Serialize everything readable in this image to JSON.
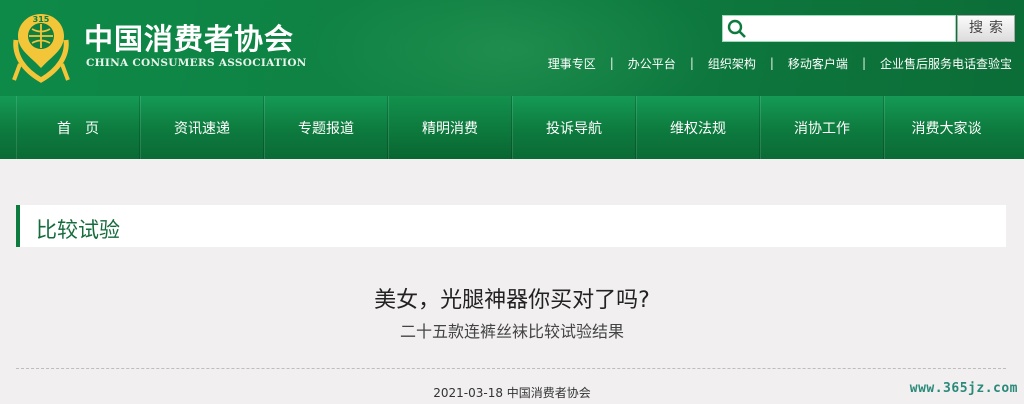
{
  "header": {
    "title_cn": "中国消费者协会",
    "title_en": "CHINA CONSUMERS ASSOCIATION",
    "brand_color": "#0f7f42"
  },
  "search": {
    "placeholder": "",
    "button_label": "搜索"
  },
  "top_links": [
    "理事专区",
    "办公平台",
    "组织架构",
    "移动客户端",
    "企业售后服务电话查验宝"
  ],
  "nav": {
    "items": [
      "首页",
      "资讯速递",
      "专题报道",
      "精明消费",
      "投诉导航",
      "维权法规",
      "消协工作",
      "消费大家谈"
    ],
    "active": "精明消费"
  },
  "section": {
    "title": "比较试验"
  },
  "article": {
    "title": "美女，光腿神器你买对了吗?",
    "subtitle": "二十五款连裤丝袜比较试验结果",
    "meta": "2021-03-18 中国消费者协会"
  },
  "watermark": "www.365jz.com",
  "icons": [
    "logo-emblem-icon",
    "search-icon"
  ]
}
